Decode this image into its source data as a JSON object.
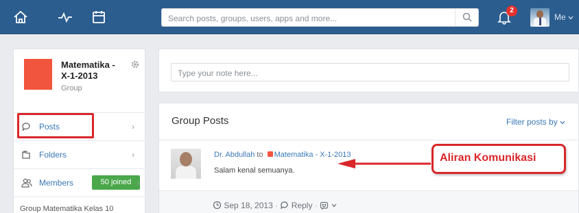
{
  "topbar": {
    "search_placeholder": "Search posts, groups, users, apps and more...",
    "notification_count": "2",
    "me_label": "Me"
  },
  "group": {
    "name": "Matematika - X-1-2013",
    "type": "Group",
    "nav": [
      {
        "label": "Posts"
      },
      {
        "label": "Folders"
      },
      {
        "label": "Members",
        "badge": "50 joined"
      }
    ],
    "description": "Group Matematika Kelas 10"
  },
  "note": {
    "placeholder": "Type your note here..."
  },
  "posts": {
    "title": "Group Posts",
    "filter_label": "Filter posts by",
    "items": [
      {
        "author": "Dr. Abdullah",
        "connector": "to",
        "group": "Matematika - X-1-2013",
        "text": "Salam kenal semuanya.",
        "date": "Sep 18, 2013",
        "reply_label": "Reply"
      }
    ]
  },
  "annotation": {
    "label": "Aliran Komunikasi"
  },
  "colors": {
    "topbar": "#2b5d8f",
    "group_avatar": "#f2553d",
    "highlight": "#d9262a",
    "badge": "#4aa74a",
    "link": "#3a78b7"
  }
}
